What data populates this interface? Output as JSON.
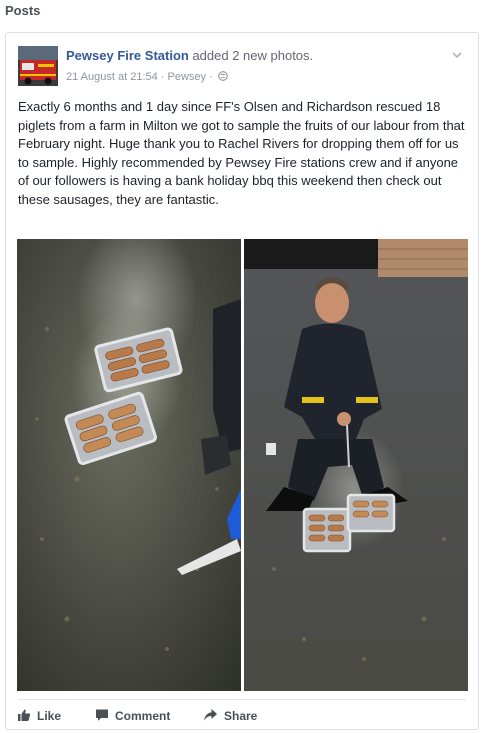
{
  "section": {
    "title": "Posts"
  },
  "post": {
    "page_name": "Pewsey Fire Station",
    "action_text": " added 2 new photos.",
    "timestamp": "21 August at 21:54",
    "separator": " · ",
    "location": "Pewsey",
    "privacy_icon": "globe-icon",
    "body": "Exactly 6 months and 1 day since FF's Olsen and Richardson rescued 18 piglets from a farm in Milton we got to sample the fruits of our labour from that February night. Huge thank you to Rachel Rivers for dropping them off for us to sample. Highly recommended by Pewsey Fire stations crew and if anyone of our followers is having a bank holiday bbq this weekend then check out these sausages, they are fantastic."
  },
  "actions": {
    "like": "Like",
    "comment": "Comment",
    "share": "Share"
  },
  "colors": {
    "link": "#365899",
    "text": "#1d2129",
    "muted": "#90949c",
    "action": "#4b4f56",
    "border": "#dddfe2"
  }
}
